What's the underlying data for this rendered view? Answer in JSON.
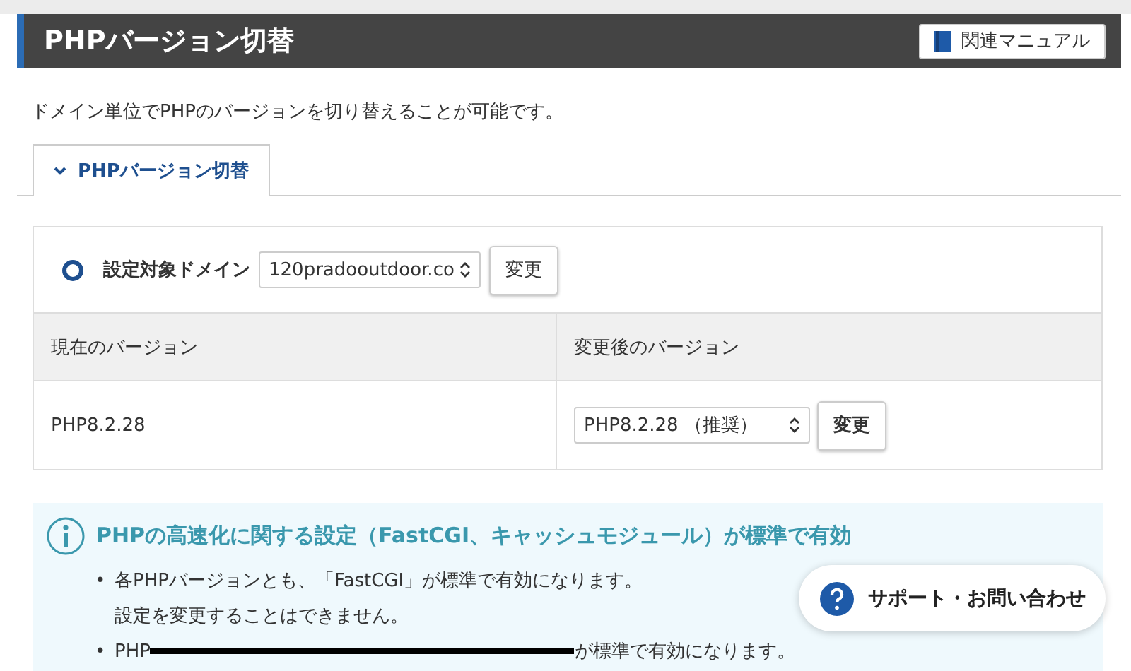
{
  "header": {
    "title": "PHPバージョン切替",
    "manual_button": "関連マニュアル"
  },
  "description": "ドメイン単位でPHPのバージョンを切り替えることが可能です。",
  "tabs": [
    {
      "label": "PHPバージョン切替",
      "selected": true
    }
  ],
  "domain_row": {
    "label": "設定対象ドメイン",
    "selected": true,
    "domain": "120pradooutdoor.co",
    "button": "変更"
  },
  "table": {
    "columns": [
      "現在のバージョン",
      "変更後のバージョン"
    ],
    "rows": [
      {
        "current": "PHP8.2.28",
        "new_version": "PHP8.2.28 （推奨）",
        "button": "変更"
      }
    ]
  },
  "info": {
    "heading": "PHPの高速化に関する設定（FastCGI、キャッシュモジュール）が標準で有効",
    "items": [
      {
        "marker": "•",
        "lines": [
          "各PHPバージョンとも、「FastCGI」が標準で有効になります。",
          "設定を変更することはできません。"
        ],
        "redacted": false
      },
      {
        "marker": "•",
        "lines": [
          "PHP",
          "が標準で有効になります。"
        ],
        "redacted": true
      }
    ]
  },
  "support_button": "サポート・お問い合わせ"
}
